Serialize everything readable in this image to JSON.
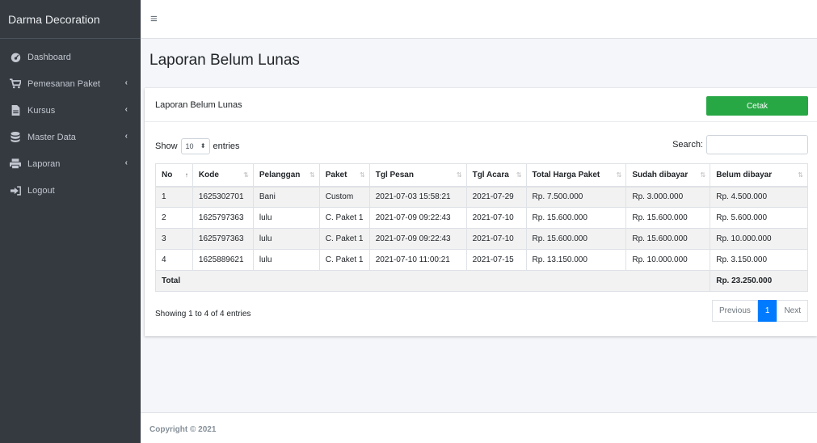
{
  "sidebar": {
    "brand": "Darma Decoration",
    "items": [
      {
        "label": "Dashboard",
        "icon": "dashboard-icon"
      },
      {
        "label": "Pemesanan Paket",
        "icon": "cart-icon"
      },
      {
        "label": "Kursus",
        "icon": "file-icon"
      },
      {
        "label": "Master Data",
        "icon": "database-icon"
      },
      {
        "label": "Laporan",
        "icon": "print-icon"
      },
      {
        "label": "Logout",
        "icon": "logout-icon"
      }
    ],
    "chevron": "‹"
  },
  "topbar": {
    "menu_icon": "≡"
  },
  "page": {
    "title": "Laporan Belum Lunas"
  },
  "card": {
    "title": "Laporan Belum Lunas",
    "print_button": "Cetak",
    "show_label": "Show",
    "entries_value": "10",
    "entries_label": "entries",
    "search_label": "Search:",
    "search_value": ""
  },
  "table": {
    "headers": [
      "No",
      "Kode",
      "Pelanggan",
      "Paket",
      "Tgl Pesan",
      "Tgl Acara",
      "Total Harga Paket",
      "Sudah dibayar",
      "Belum dibayar"
    ],
    "rows": [
      [
        "1",
        "1625302701",
        "Bani",
        "Custom",
        "2021-07-03 15:58:21",
        "2021-07-29",
        "Rp. 7.500.000",
        "Rp. 3.000.000",
        "Rp. 4.500.000"
      ],
      [
        "2",
        "1625797363",
        "lulu",
        "C. Paket 1",
        "2021-07-09 09:22:43",
        "2021-07-10",
        "Rp. 15.600.000",
        "Rp. 15.600.000",
        "Rp. 5.600.000"
      ],
      [
        "3",
        "1625797363",
        "lulu",
        "C. Paket 1",
        "2021-07-09 09:22:43",
        "2021-07-10",
        "Rp. 15.600.000",
        "Rp. 15.600.000",
        "Rp. 10.000.000"
      ],
      [
        "4",
        "1625889621",
        "lulu",
        "C. Paket 1",
        "2021-07-10 11:00:21",
        "2021-07-15",
        "Rp. 13.150.000",
        "Rp. 10.000.000",
        "Rp. 3.150.000"
      ]
    ],
    "total_label": "Total",
    "total_value": "Rp. 23.250.000"
  },
  "pagination": {
    "info": "Showing 1 to 4 of 4 entries",
    "previous": "Previous",
    "current": "1",
    "next": "Next"
  },
  "footer": {
    "copyright": "Copyright © 2021"
  }
}
